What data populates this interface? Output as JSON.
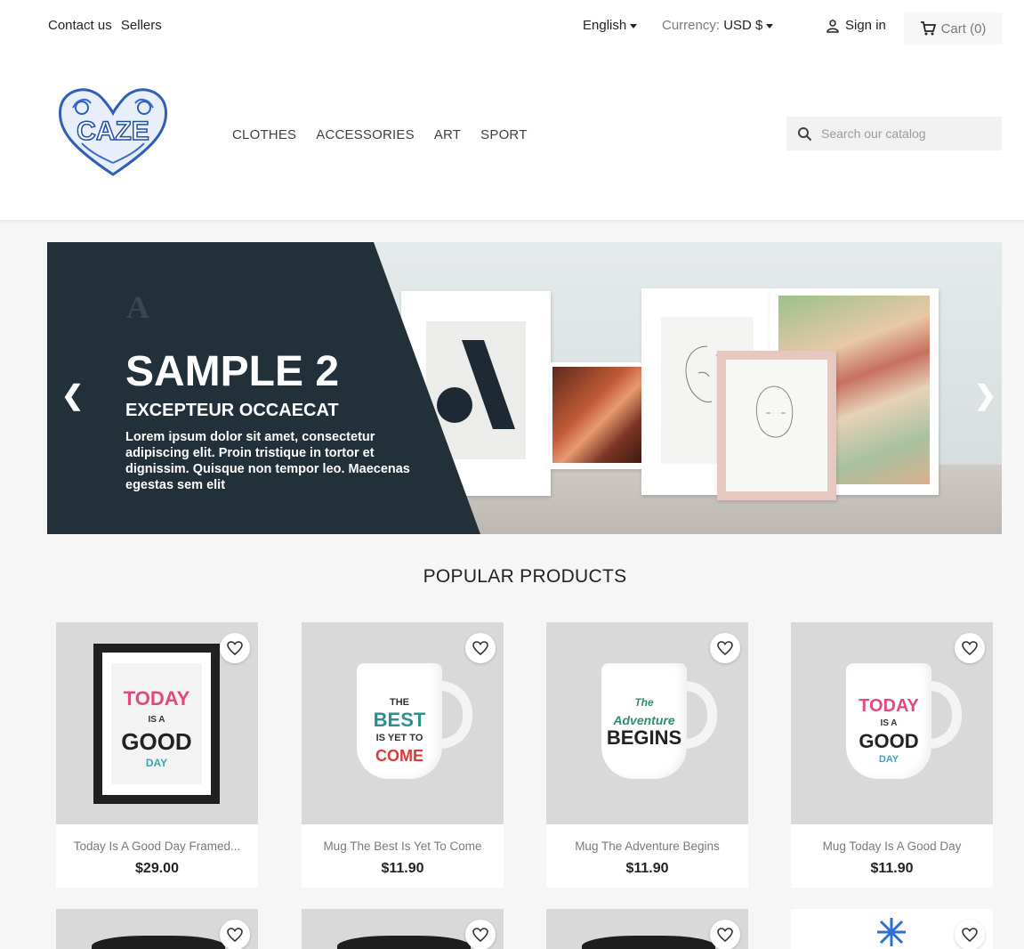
{
  "topbar": {
    "contact_label": "Contact us",
    "sellers_label": "Sellers",
    "language_label": "English",
    "currency_prefix": "Currency:",
    "currency_value": "USD $",
    "signin_label": "Sign in",
    "cart_label": "Cart (0)"
  },
  "header": {
    "logo_text": "CAZE",
    "menu": [
      "CLOTHES",
      "ACCESSORIES",
      "ART",
      "SPORT"
    ],
    "search_placeholder": "Search our catalog"
  },
  "slider": {
    "brand_mark": "A",
    "title": "SAMPLE 2",
    "subtitle": "EXCEPTEUR OCCAECAT",
    "text": "Lorem ipsum dolor sit amet, consectetur adipiscing elit. Proin tristique in tortor et dignissim. Quisque non tempor leo. Maecenas egestas sem elit",
    "poster_letter": "A"
  },
  "popular": {
    "title": "POPULAR PRODUCTS",
    "products": [
      {
        "name": "Today Is A Good Day Framed...",
        "price": "$29.00",
        "art": [
          "TODAY",
          "IS A",
          "GOOD",
          "DAY"
        ]
      },
      {
        "name": "Mug The Best Is Yet To Come",
        "price": "$11.90",
        "art": [
          "THE",
          "BEST",
          "IS YET TO",
          "COME"
        ]
      },
      {
        "name": "Mug The Adventure Begins",
        "price": "$11.90",
        "art": [
          "The",
          "Adventure",
          "BEGINS"
        ]
      },
      {
        "name": "Mug Today Is A Good Day",
        "price": "$11.90",
        "art": [
          "TODAY",
          "IS A",
          "GOOD",
          "DAY"
        ]
      }
    ]
  },
  "colors": {
    "accent_dark": "#22303a",
    "pink": "#e14b7b",
    "teal": "#2f8f8f",
    "red": "#d93a3a"
  }
}
